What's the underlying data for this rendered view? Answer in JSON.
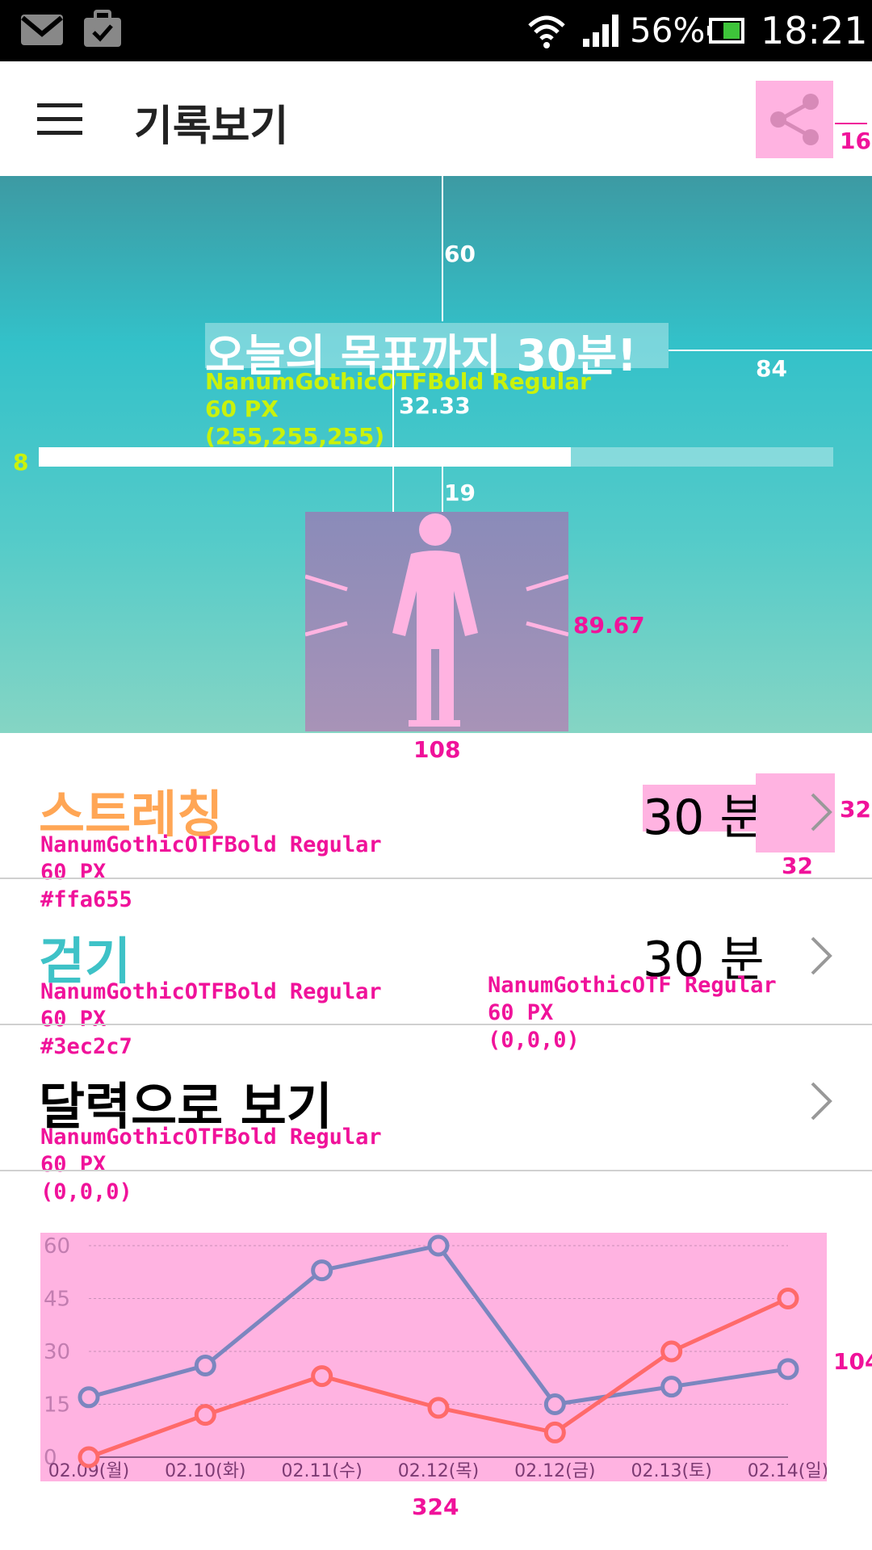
{
  "status_bar": {
    "battery": "56%",
    "time": "18:21",
    "icons": [
      "gmail-icon",
      "briefcase-check-icon",
      "wifi-icon",
      "signal-icon",
      "battery-icon"
    ]
  },
  "app_bar": {
    "title": "기록보기",
    "menu_icon": "hamburger-icon",
    "share_icon": "share-icon",
    "share_margin_anno": "16"
  },
  "hero": {
    "headline": "오늘의 목표까지 30분!",
    "progress": 0.67,
    "spec_font": "NanumGothicOTFBold Regular",
    "spec_size": "60 PX",
    "spec_color": "(255,255,255)",
    "anno_top": "60",
    "anno_right": "84",
    "anno_gap": "32.33",
    "anno_bar_height": "8",
    "anno_gap2": "19",
    "anno_fig_h": "89.67",
    "anno_fig_w": "108",
    "figure_icon": "person-icon"
  },
  "rows": [
    {
      "title": "스트레칭",
      "value": "30 분",
      "title_color": "#ffa655",
      "spec": [
        "NanumGothicOTFBold Regular",
        "60 PX",
        "#ffa655"
      ],
      "anno_chev_h": "32",
      "anno_chev_w": "32"
    },
    {
      "title": "걷기",
      "value": "30 분",
      "title_color": "#3ec2c7",
      "spec": [
        "NanumGothicOTFBold Regular",
        "60 PX",
        "#3ec2c7"
      ],
      "value_spec": [
        "NanumGothicOTF Regular",
        "60 PX",
        "(0,0,0)"
      ]
    },
    {
      "title": "달력으로 보기",
      "title_color": "#000000",
      "spec": [
        "NanumGothicOTFBold Regular",
        "60 PX",
        "(0,0,0)"
      ]
    }
  ],
  "chart_data": {
    "type": "line",
    "categories": [
      "02.09(월)",
      "02.10(화)",
      "02.11(수)",
      "02.12(목)",
      "02.12(금)",
      "02.13(토)",
      "02.14(일)"
    ],
    "y_ticks": [
      "0",
      "15",
      "30",
      "45",
      "60"
    ],
    "ylim": [
      0,
      60
    ],
    "grid": true,
    "series": [
      {
        "values": [
          17,
          26,
          53,
          60,
          15,
          20,
          25
        ],
        "color": "#7b86bf"
      },
      {
        "values": [
          0,
          12,
          23,
          14,
          7,
          30,
          45
        ],
        "color": "#ff6a6a"
      }
    ],
    "anno_height": "104",
    "anno_width": "324"
  }
}
